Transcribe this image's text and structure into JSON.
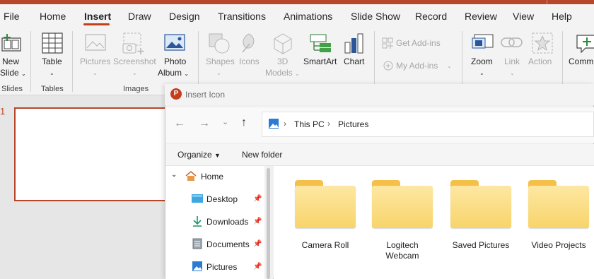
{
  "tabs": [
    "File",
    "Home",
    "Insert",
    "Draw",
    "Design",
    "Transitions",
    "Animations",
    "Slide Show",
    "Record",
    "Review",
    "View",
    "Help"
  ],
  "active_tab": "Insert",
  "ribbon": {
    "new_slide": [
      "New",
      "Slide"
    ],
    "table": "Table",
    "pictures": "Pictures",
    "screenshot": "Screenshot",
    "photo_album": [
      "Photo",
      "Album"
    ],
    "shapes": "Shapes",
    "icons": "Icons",
    "models_3d": [
      "3D",
      "Models"
    ],
    "smartart": "SmartArt",
    "chart": "Chart",
    "get_addins": "Get Add-ins",
    "my_addins": "My Add-ins",
    "zoom": "Zoom",
    "link": "Link",
    "action": "Action",
    "comment": "Comm",
    "groups": {
      "slides": "Slides",
      "tables": "Tables",
      "images": "Images"
    }
  },
  "slide_number": "1",
  "dialog": {
    "title": "Insert Icon",
    "breadcrumb": [
      "This PC",
      "Pictures"
    ],
    "commands": {
      "organize": "Organize",
      "new_folder": "New folder"
    },
    "nav_items": [
      {
        "label": "Home",
        "pinned": false
      },
      {
        "label": "Desktop",
        "pinned": true
      },
      {
        "label": "Downloads",
        "pinned": true
      },
      {
        "label": "Documents",
        "pinned": true
      },
      {
        "label": "Pictures",
        "pinned": true
      }
    ],
    "folders": [
      [
        "Camera Roll"
      ],
      [
        "Logitech",
        "Webcam"
      ],
      [
        "Saved Pictures"
      ],
      [
        "Video Projects"
      ]
    ]
  },
  "colors": {
    "accent": "#c43e1c",
    "folder": "#f8d46a"
  }
}
